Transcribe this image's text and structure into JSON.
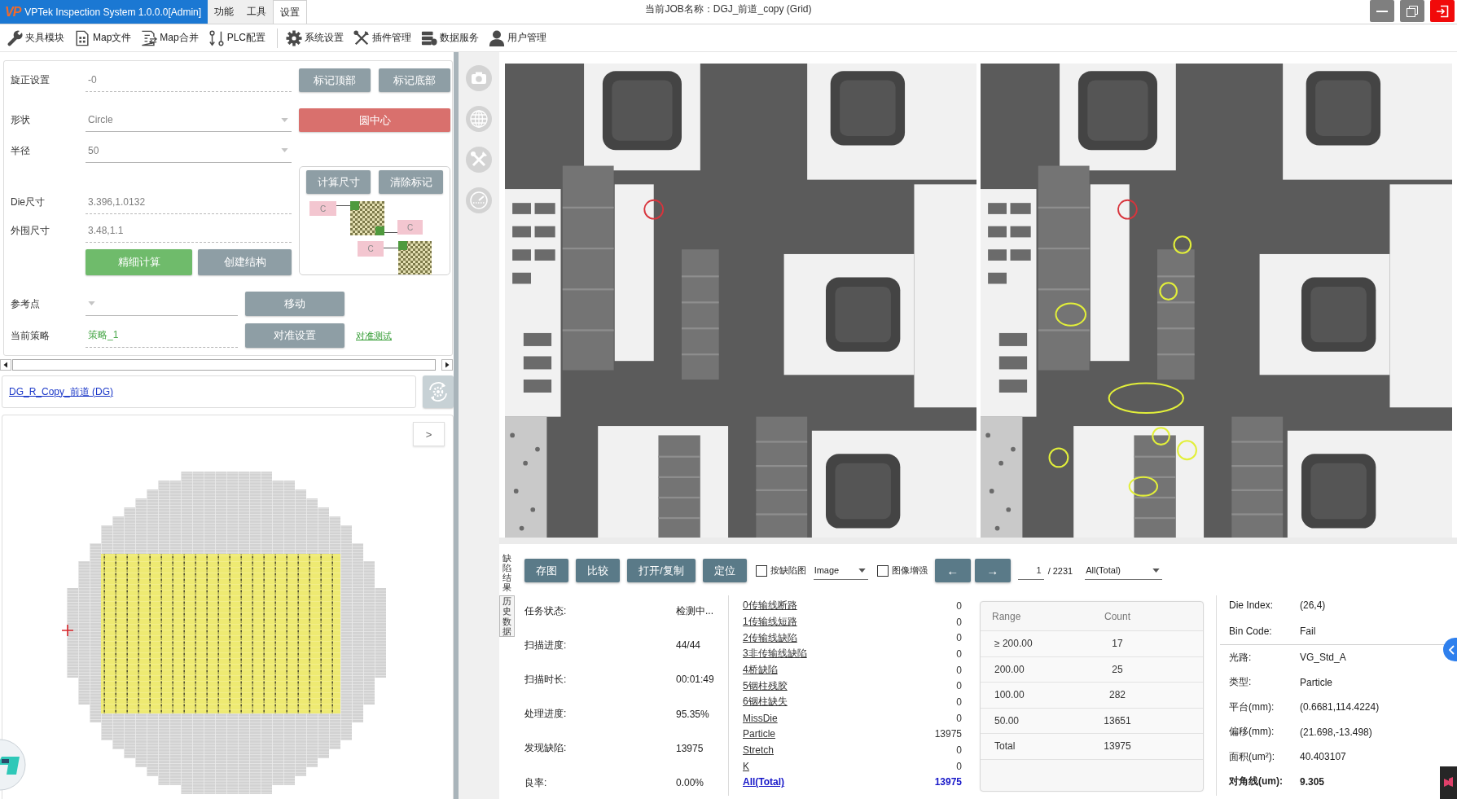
{
  "title_bar": {
    "logo": "VP",
    "title": "VPTek Inspection System 1.0.0.0[Admin]",
    "menus": [
      {
        "label": "功能",
        "selected": false
      },
      {
        "label": "工具",
        "selected": false
      },
      {
        "label": "设置",
        "selected": true
      }
    ],
    "job": "当前JOB名称：DGJ_前道_copy (Grid)"
  },
  "toolbar": {
    "groups": [
      [
        "夹具模块",
        "Map文件",
        "Map合并",
        "PLC配置"
      ],
      [
        "系统设置",
        "插件管理",
        "数据服务",
        "用户管理"
      ]
    ]
  },
  "alignment": {
    "rotation": {
      "label": "旋正设置",
      "value": "-0"
    },
    "mark_buttons": [
      "标记顶部",
      "标记底部"
    ],
    "shape": {
      "label": "形状",
      "value": "Circle"
    },
    "center_button": "圆中心",
    "radius": {
      "label": "半径",
      "value": "50"
    },
    "calibration": {
      "buttons": [
        "计算尺寸",
        "清除标记"
      ],
      "tags": [
        "C",
        "C",
        "C"
      ]
    },
    "die_size": {
      "label": "Die尺寸",
      "value": "3.396,1.0132"
    },
    "outer_size": {
      "label": "外围尺寸",
      "value": "3.48,1.1"
    },
    "compute_buttons": [
      {
        "label": "精细计算",
        "kind": "success"
      },
      {
        "label": "创建结构",
        "kind": "default"
      }
    ],
    "reference": {
      "label": "参考点"
    },
    "move_button": "移动",
    "strategy": {
      "label": "当前策略",
      "value": "策略_1"
    },
    "align_button": "对准设置",
    "test_link": "对准测试"
  },
  "recipe_link": "DG_R_Copy_前道 (DG)",
  "wafer_map": {
    "next_button": ">"
  },
  "result_tabs": [
    {
      "label": "缺陷结果",
      "selected": true
    },
    {
      "label": "历史数据",
      "selected": false
    }
  ],
  "result_toolbar": {
    "buttons": [
      "存图",
      "比较",
      "打开/复制",
      "定位"
    ],
    "defect_map": {
      "label": "按缺陷图",
      "checked": false
    },
    "image_mode": "Image",
    "enhance": {
      "label": "图像增强",
      "checked": false
    },
    "prev": "←",
    "next": "→",
    "page": "1",
    "page_total": "/ 2231",
    "filter": "All(Total)"
  },
  "status": [
    {
      "label": "任务状态:",
      "value": "检测中..."
    },
    {
      "label": "扫描进度:",
      "value": "44/44"
    },
    {
      "label": "扫描时长:",
      "value": "00:01:49"
    },
    {
      "label": "处理进度:",
      "value": "95.35%"
    },
    {
      "label": "发现缺陷:",
      "value": "13975"
    },
    {
      "label": "良率:",
      "value": "0.00%"
    }
  ],
  "defect_types": [
    {
      "name": "0传输线断路",
      "count": "0",
      "kind": "type"
    },
    {
      "name": "1传输线短路",
      "count": "0",
      "kind": "type"
    },
    {
      "name": "2传输线缺陷",
      "count": "0",
      "kind": "type"
    },
    {
      "name": "3非传输线缺陷",
      "count": "0",
      "kind": "type"
    },
    {
      "name": "4桥缺陷",
      "count": "0",
      "kind": "type"
    },
    {
      "name": "5铟柱残胶",
      "count": "0",
      "kind": "type"
    },
    {
      "name": "6铟柱缺失",
      "count": "0",
      "kind": "type"
    },
    {
      "name": "MissDie",
      "count": "0",
      "kind": "type"
    },
    {
      "name": "Particle",
      "count": "13975",
      "kind": "type"
    },
    {
      "name": "Stretch",
      "count": "0",
      "kind": "type"
    },
    {
      "name": "K",
      "count": "0",
      "kind": "type"
    },
    {
      "name": "All(Total)",
      "count": "13975",
      "kind": "total"
    }
  ],
  "range_table": {
    "columns": [
      "Range",
      "Count"
    ],
    "rows": [
      [
        "≥ 200.00",
        "17"
      ],
      [
        "200.00",
        "25"
      ],
      [
        "100.00",
        "282"
      ],
      [
        "50.00",
        "13651"
      ],
      [
        "Total",
        "13975"
      ]
    ]
  },
  "die_info": [
    {
      "label": "Die Index:",
      "value": "(26,4)"
    },
    {
      "label": "Bin Code:",
      "value": "Fail"
    }
  ],
  "defect_info": [
    {
      "label": "光路:",
      "value": "VG_Std_A",
      "kind": "normal"
    },
    {
      "label": "类型:",
      "value": "Particle",
      "kind": "normal"
    },
    {
      "label": "平台(mm):",
      "value": "(0.6681,114.4224)",
      "kind": "normal"
    },
    {
      "label": "偏移(mm):",
      "value": "(21.698,-13.498)",
      "kind": "normal"
    },
    {
      "label": "面积(um²):",
      "value": "40.403107",
      "kind": "normal"
    },
    {
      "label": "对角线(um):",
      "value": "9.305",
      "kind": "strong"
    }
  ]
}
